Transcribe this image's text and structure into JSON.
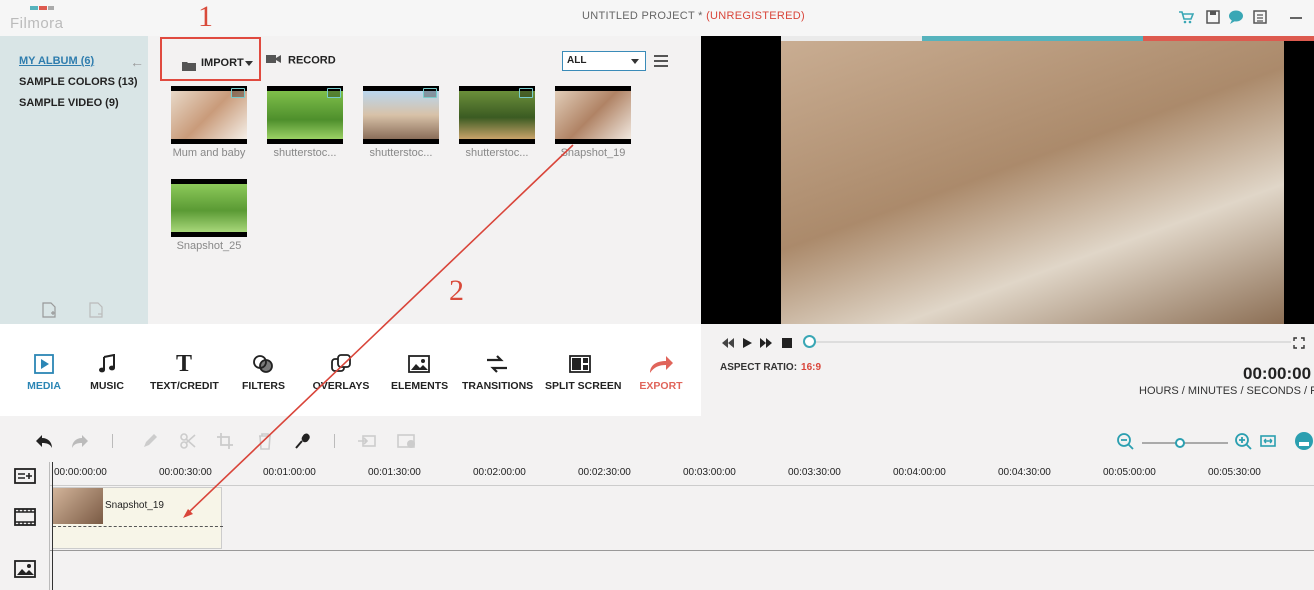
{
  "app": {
    "logo_text": "Filmora",
    "project_title": "UNTITLED PROJECT *",
    "registration": "(UNREGISTERED)"
  },
  "titlebar_icons": [
    "cart-icon",
    "save-icon",
    "chat-icon",
    "list-icon",
    "minimize-icon"
  ],
  "album": {
    "items": [
      {
        "label": "MY ALBUM (6)",
        "active": true
      },
      {
        "label": "SAMPLE COLORS (13)",
        "active": false
      },
      {
        "label": "SAMPLE VIDEO (9)",
        "active": false
      }
    ]
  },
  "library": {
    "import_label": "IMPORT",
    "record_label": "RECORD",
    "filter_value": "ALL",
    "items": [
      {
        "caption": "Mum and baby"
      },
      {
        "caption": "shutterstoc..."
      },
      {
        "caption": "shutterstoc..."
      },
      {
        "caption": "shutterstoc..."
      },
      {
        "caption": "Snapshot_19"
      },
      {
        "caption": "Snapshot_25"
      }
    ]
  },
  "annotations": {
    "step1": "1",
    "step2": "2"
  },
  "tools": [
    {
      "label": "MEDIA",
      "icon": "media-icon"
    },
    {
      "label": "MUSIC",
      "icon": "music-icon"
    },
    {
      "label": "TEXT/CREDIT",
      "icon": "text-icon"
    },
    {
      "label": "FILTERS",
      "icon": "filters-icon"
    },
    {
      "label": "OVERLAYS",
      "icon": "overlays-icon"
    },
    {
      "label": "ELEMENTS",
      "icon": "elements-icon"
    },
    {
      "label": "TRANSITIONS",
      "icon": "transitions-icon"
    },
    {
      "label": "SPLIT SCREEN",
      "icon": "split-screen-icon"
    },
    {
      "label": "EXPORT",
      "icon": "export-icon"
    }
  ],
  "player": {
    "aspect_label": "ASPECT RATIO:",
    "aspect_value": "16:9",
    "timecode": "00:00:00",
    "timecode_units": "HOURS / MINUTES / SECONDS / FR"
  },
  "timeline": {
    "ticks": [
      "00:00:00:00",
      "00:00:30:00",
      "00:01:00:00",
      "00:01:30:00",
      "00:02:00:00",
      "00:02:30:00",
      "00:03:00:00",
      "00:03:30:00",
      "00:04:00:00",
      "00:04:30:00",
      "00:05:00:00",
      "00:05:30:00"
    ],
    "clip_label": "Snapshot_19"
  },
  "colors": {
    "accent": "#2b86b5",
    "brand_red": "#d9453a",
    "teal": "#56b3bd"
  }
}
